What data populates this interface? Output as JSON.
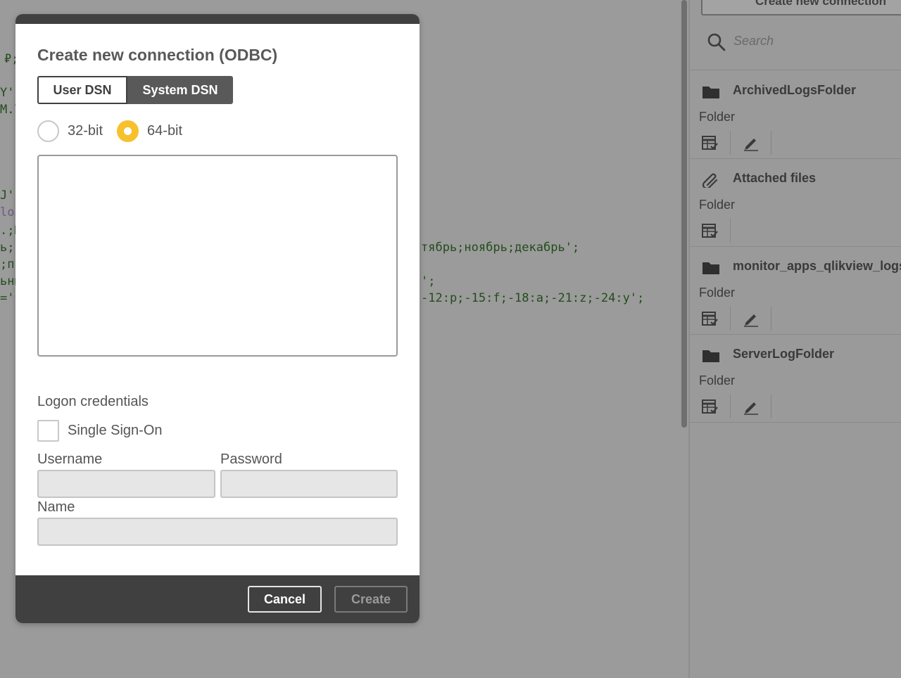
{
  "editor": {
    "lines": [
      {
        "text": "₽;",
        "cls": ""
      },
      {
        "text": "Y'",
        "cls": ""
      },
      {
        "text": "M.Y",
        "cls": ""
      },
      {
        "text": "J',",
        "cls": ""
      },
      {
        "text": "loa",
        "cls": "purple"
      },
      {
        "text": ".;M",
        "cls": ""
      },
      {
        "text": "ь;с",
        "cls": ""
      },
      {
        "text": ";п",
        "cls": ""
      },
      {
        "text": "ьны",
        "cls": ""
      },
      {
        "text": "='",
        "cls": ""
      }
    ],
    "right_lines": [
      {
        "text": "тябрь;ноябрь;декабрь';",
        "cls": ""
      },
      {
        "text": "';",
        "cls": ""
      },
      {
        "text": "-12:p;-15:f;-18:a;-21:z;-24:y';",
        "cls": ""
      }
    ]
  },
  "panel": {
    "create_button_label": "Create new connection",
    "search_placeholder": "Search",
    "connections": [
      {
        "name": "ArchivedLogsFolder",
        "type": "Folder",
        "icon": "folder-icon",
        "editable": true
      },
      {
        "name": "Attached files",
        "type": "Folder",
        "icon": "paperclip-icon",
        "editable": false
      },
      {
        "name": "monitor_apps_qlikview_logs",
        "type": "Folder",
        "icon": "folder-icon",
        "editable": true
      },
      {
        "name": "ServerLogFolder",
        "type": "Folder",
        "icon": "folder-icon",
        "editable": true
      }
    ]
  },
  "dialog": {
    "title": "Create new connection (ODBC)",
    "tabs": {
      "user": "User DSN",
      "system": "System DSN",
      "active": "system"
    },
    "bitness": {
      "option_32": "32-bit",
      "option_64": "64-bit",
      "selected": "64-bit"
    },
    "credentials_heading": "Logon credentials",
    "sso_label": "Single Sign-On",
    "sso_checked": false,
    "username_label": "Username",
    "username_value": "",
    "password_label": "Password",
    "password_value": "",
    "name_label": "Name",
    "name_value": "",
    "cancel_label": "Cancel",
    "create_label": "Create"
  },
  "colors": {
    "accent": "#f7c12e",
    "dark": "#404040",
    "overlay": "#999999"
  }
}
